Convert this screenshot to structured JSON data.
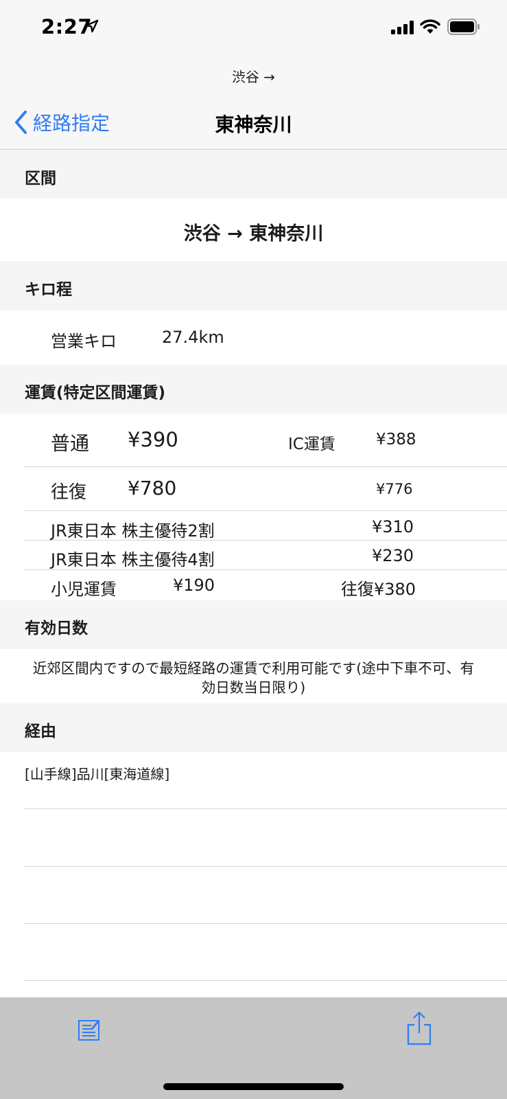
{
  "status_bar": {
    "time": "2:27"
  },
  "nav": {
    "prompt": "渋谷 →",
    "back_label": "経路指定",
    "title": "東神奈川"
  },
  "sections": {
    "route": {
      "header": "区間",
      "value": "渋谷 → 東神奈川"
    },
    "distance": {
      "header": "キロ程",
      "label": "営業キロ",
      "value": "27.4km"
    },
    "fare": {
      "header": "運賃(特定区間運賃)",
      "normal_label": "普通",
      "normal_value": "¥390",
      "ic_label": "IC運賃",
      "ic_value": "¥388",
      "round_label": "往復",
      "round_value": "¥780",
      "round_ic_value": "¥776",
      "discount2_label": "JR東日本 株主優待2割",
      "discount2_value": "¥310",
      "discount4_label": "JR東日本 株主優待4割",
      "discount4_value": "¥230",
      "child_label": "小児運賃",
      "child_value": "¥190",
      "child_round": "往復¥380"
    },
    "validity": {
      "header": "有効日数",
      "text_line1": "近郊区間内ですので最短経路の運賃で利用可能です(途中下車不可、有",
      "text_line2": "効日数当日限り)"
    },
    "via": {
      "header": "経由",
      "value": "[山手線]品川[東海道線]"
    }
  },
  "toolbar": {
    "left_icon": "memo-edit-icon",
    "right_icon": "share-icon"
  },
  "colors": {
    "accent": "#2f7cf6",
    "section_bg": "#f5f5f5",
    "toolbar_bg": "#c6c6c6"
  }
}
